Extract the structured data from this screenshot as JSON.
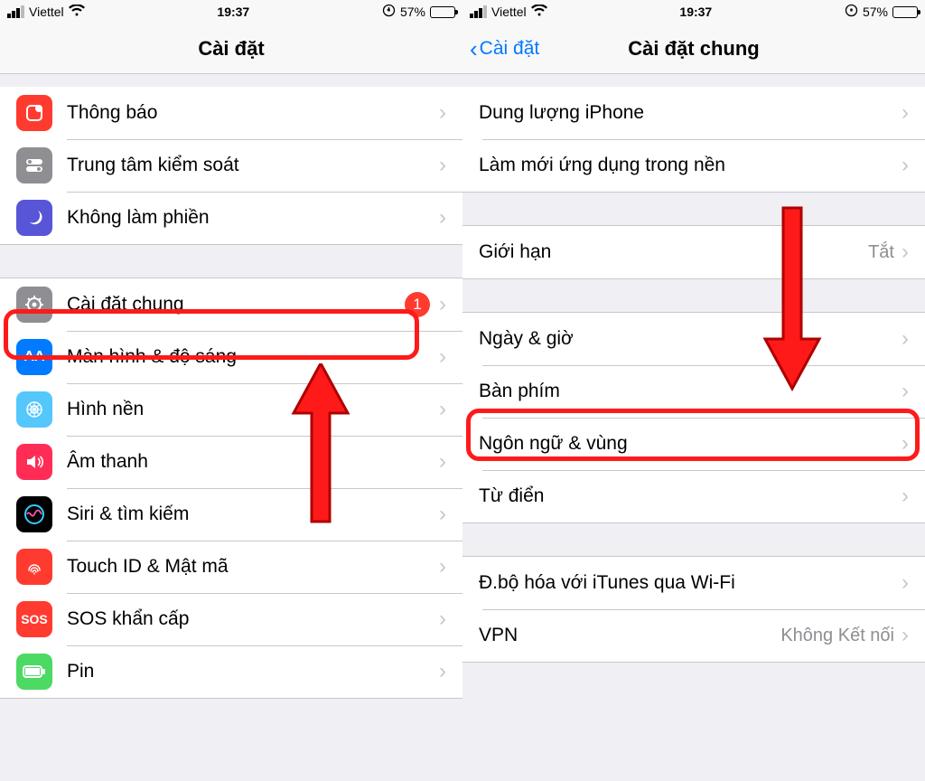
{
  "status": {
    "carrier": "Viettel",
    "time": "19:37",
    "battery_pct": "57%"
  },
  "left": {
    "title": "Cài đặt",
    "group1": [
      {
        "label": "Thông báo"
      },
      {
        "label": "Trung tâm kiểm soát"
      },
      {
        "label": "Không làm phiền"
      }
    ],
    "group2": [
      {
        "label": "Cài đặt chung",
        "badge": "1"
      },
      {
        "label": "Màn hình & độ sáng"
      },
      {
        "label": "Hình nền"
      },
      {
        "label": "Âm thanh"
      },
      {
        "label": "Siri & tìm kiếm"
      },
      {
        "label": "Touch ID & Mật mã"
      },
      {
        "label": "SOS khẩn cấp"
      },
      {
        "label": "Pin"
      }
    ]
  },
  "right": {
    "back": "Cài đặt",
    "title": "Cài đặt chung",
    "group1": [
      {
        "label": "Dung lượng iPhone"
      },
      {
        "label": "Làm mới ứng dụng trong nền"
      }
    ],
    "group2": [
      {
        "label": "Giới hạn",
        "value": "Tắt"
      }
    ],
    "group3": [
      {
        "label": "Ngày & giờ"
      },
      {
        "label": "Bàn phím"
      },
      {
        "label": "Ngôn ngữ & vùng"
      },
      {
        "label": "Từ điển"
      }
    ],
    "group4": [
      {
        "label": "Đ.bộ hóa với iTunes qua Wi-Fi"
      },
      {
        "label": "VPN",
        "value": "Không Kết nối"
      }
    ]
  }
}
